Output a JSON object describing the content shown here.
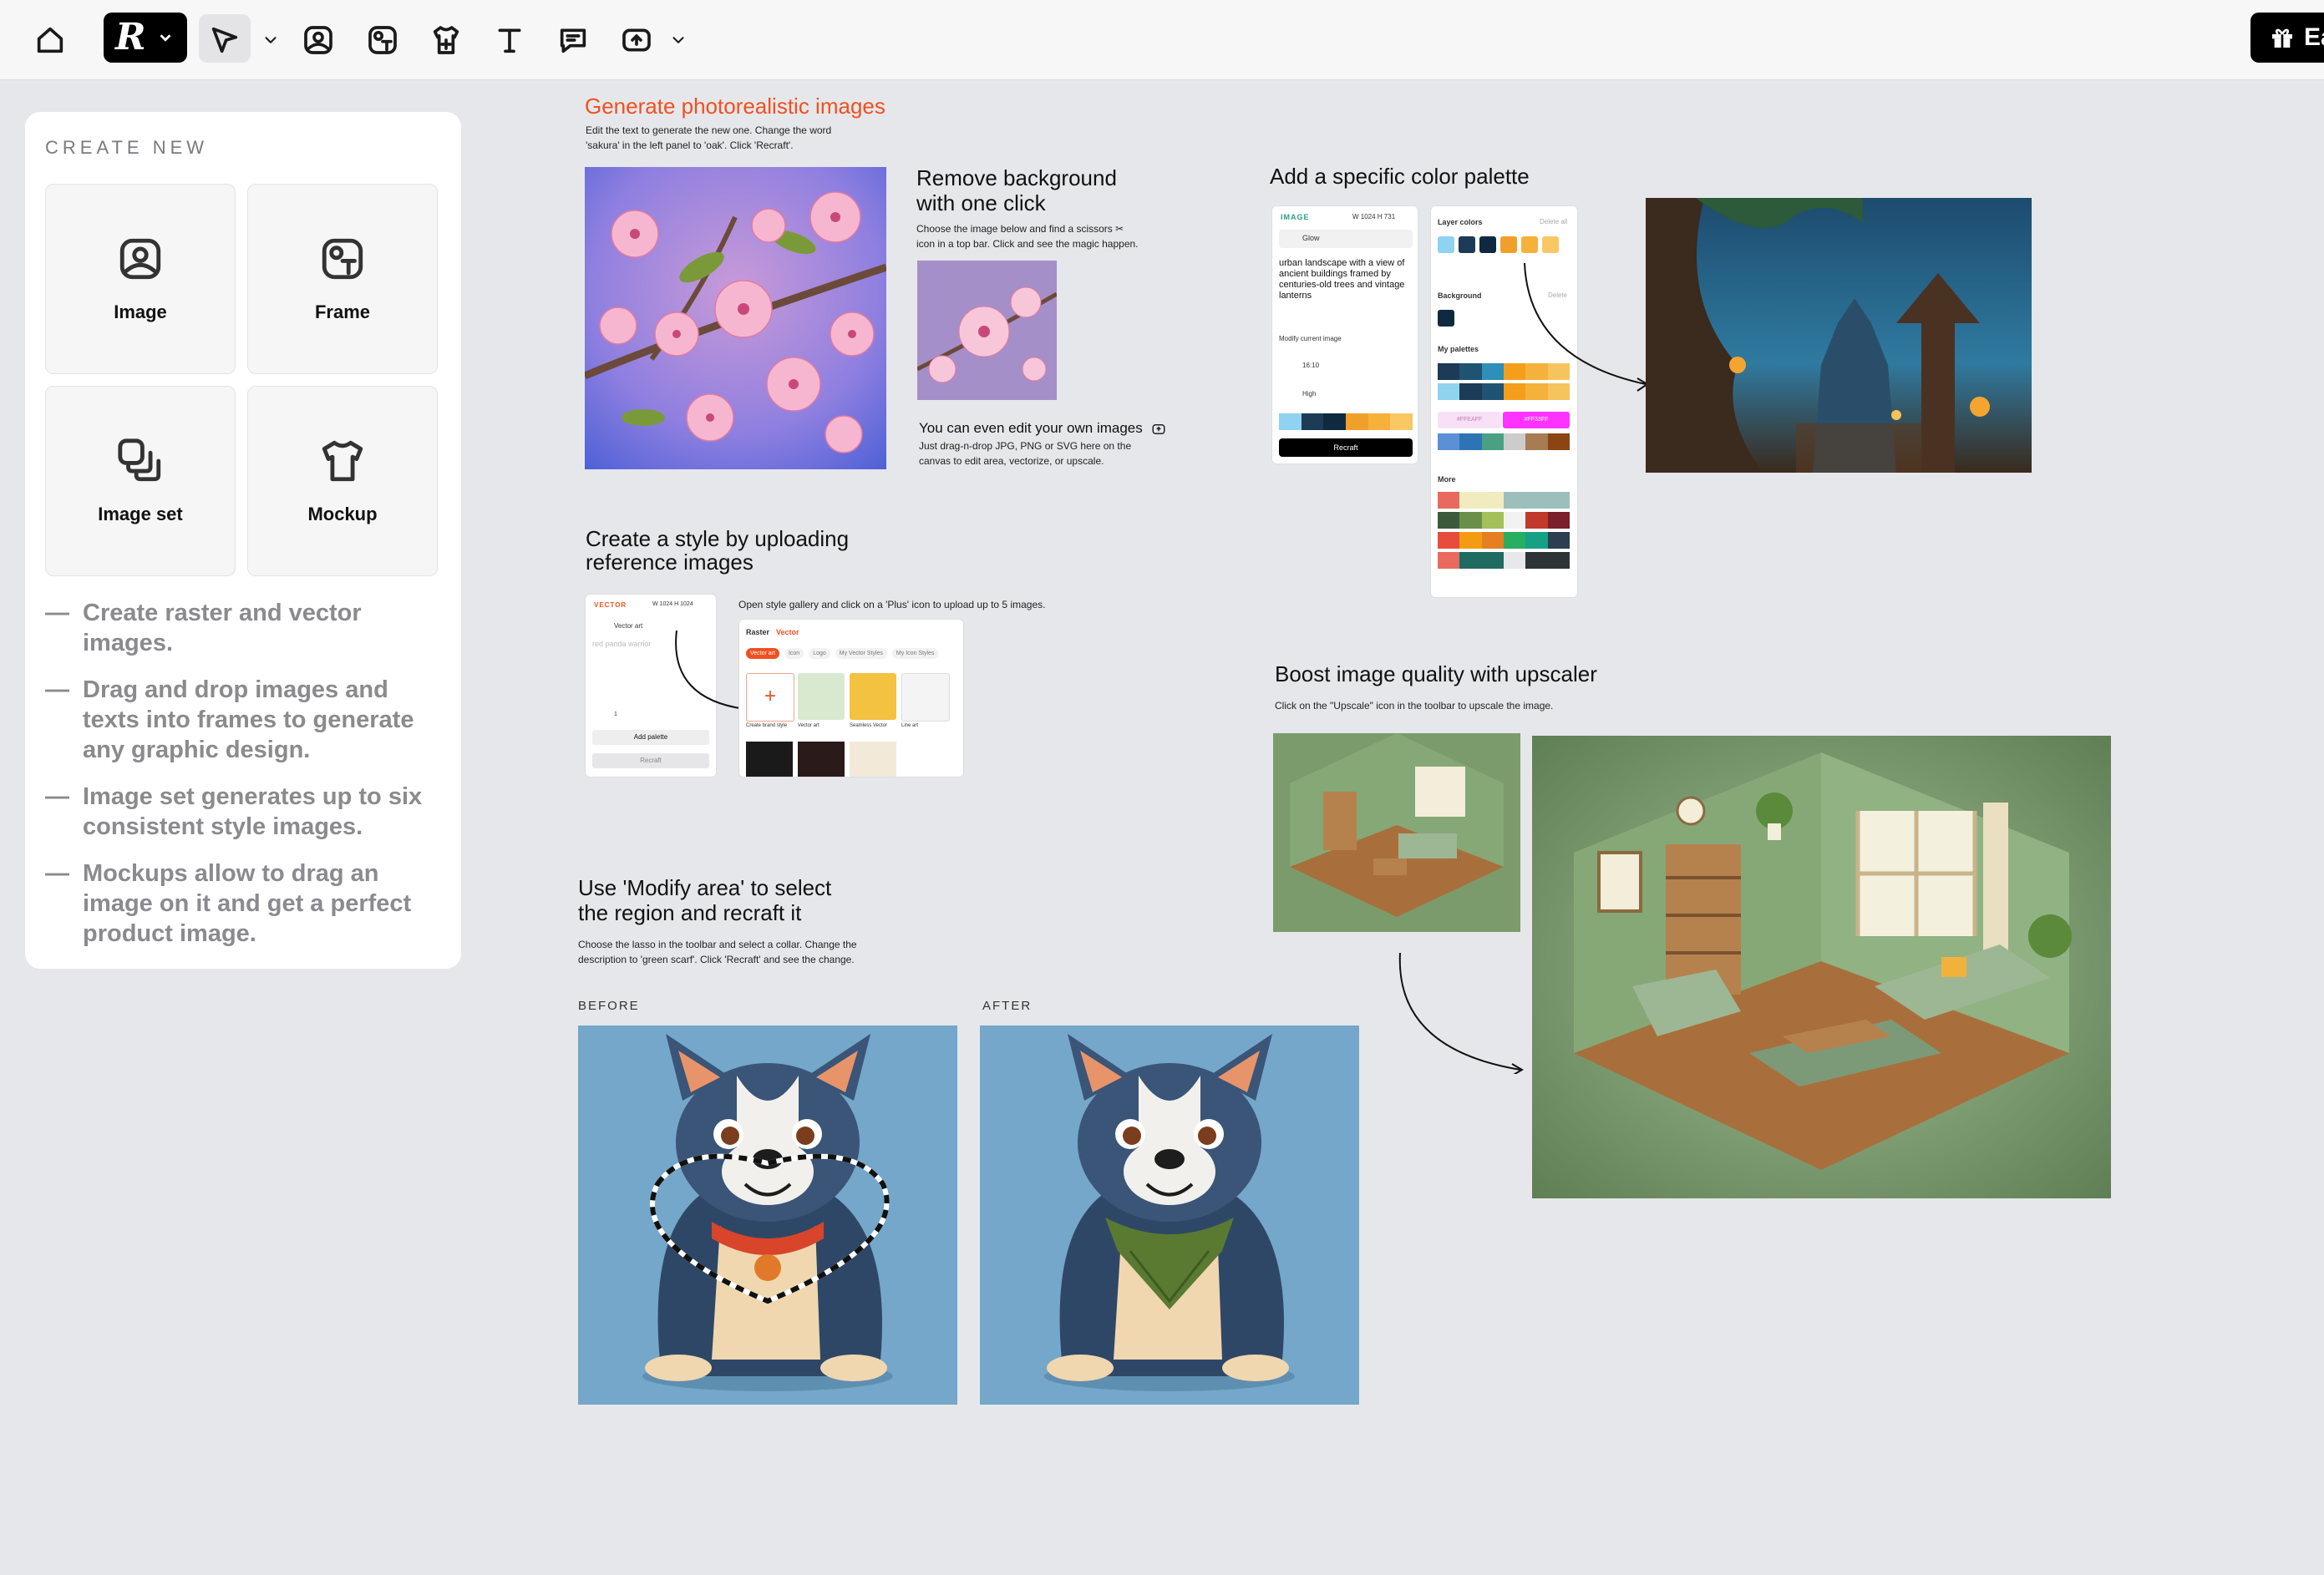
{
  "toolbar": {
    "icons": [
      "home-icon",
      "logo-menu",
      "select-tool-icon",
      "image-tool-icon",
      "frame-tool-icon",
      "mockup-tool-icon",
      "text-tool-icon",
      "comment-tool-icon",
      "upload-tool-icon"
    ],
    "logo_letter": "R",
    "gift_label": "Ea"
  },
  "panel": {
    "title": "CREATE NEW",
    "cards": [
      {
        "label": "Image",
        "icon": "image-icon"
      },
      {
        "label": "Frame",
        "icon": "frame-icon"
      },
      {
        "label": "Image set",
        "icon": "image-set-icon"
      },
      {
        "label": "Mockup",
        "icon": "mockup-icon"
      }
    ],
    "tips": [
      "Create raster and vector images.",
      "Drag and drop images and texts into frames to generate any graphic design.",
      "Image set generates up to six consistent style images.",
      "Mockups allow to drag an image on it and get a perfect product image."
    ]
  },
  "canvas": {
    "photoreal": {
      "title": "Generate photorealistic images",
      "desc1": "Edit the text to generate the new one. Change the word",
      "desc2": "'sakura' in the left panel to 'oak'. Click 'Recraft'."
    },
    "removebg": {
      "title1": "Remove background",
      "title2": "with one click",
      "desc1": "Choose the image below and find a scissors ✂",
      "desc2": "icon in a top bar. Click and see the magic happen.",
      "edit_title": "You can even edit your own images",
      "edit_desc1": "Just drag-n-drop JPG, PNG or SVG here on the",
      "edit_desc2": "canvas to edit area, vectorize, or upscale."
    },
    "palette": {
      "title": "Add a specific color palette",
      "mini_header": "IMAGE",
      "mini_dims": "W 1024  H 731",
      "mini_style": "Glow",
      "mini_prompt": "urban landscape with a view of ancient buildings framed by centuries-old trees and vintage lanterns",
      "mini_modify": "Modify current image",
      "mini_ratio": "16:10",
      "mini_quality": "High",
      "mini_button": "Recraft",
      "layer_colors": "Layer colors",
      "delete_all": "Delete all",
      "background": "Background",
      "delete": "Delete",
      "my_palettes": "My palettes",
      "more": "More",
      "hex1": "#FFEAFF",
      "hex2": "#FF33FF",
      "layer_swatches": [
        "#8fd3f0",
        "#1d3a57",
        "#0f2a40",
        "#f0a02a",
        "#f6b13a",
        "#f9c763"
      ],
      "palette_rows": [
        [
          "#1b3b56",
          "#1f5372",
          "#2e8fb8",
          "#f59e1b",
          "#f4b23c",
          "#f6c45d"
        ],
        [
          "#8fd3ef",
          "#1b3b56",
          "#1f5372",
          "#f59e1b",
          "#f4b23c",
          "#f6c45d"
        ],
        [
          "#5b8fd6",
          "#2e74b5",
          "#4aa083",
          "#cccccc",
          "#a67c52",
          "#8b4513"
        ],
        [
          "#e86a5e",
          "#f1ecc0",
          "#f1ecc0",
          "#9dbfbc",
          "#9dbfbc",
          "#9dbfbc"
        ],
        [
          "#3c5a3b",
          "#6a8f4a",
          "#a3c05a",
          "#f2f2f2",
          "#c0392b",
          "#7a1f2b"
        ],
        [
          "#e74c3c",
          "#f39c12",
          "#e67e22",
          "#27ae60",
          "#16a085",
          "#2c3e50"
        ],
        [
          "#e86a5e",
          "#1f6b62",
          "#1f6b62",
          "#e8e8ea",
          "#2d3436",
          "#2d3436"
        ]
      ]
    },
    "style": {
      "title1": "Create a style by uploading",
      "title2": "reference images",
      "desc": "Open style gallery and click on a 'Plus' icon to upload up to 5 images.",
      "mini_header": "VECTOR",
      "mini_dims": "W 1024  H 1024",
      "mini_style": "Vector art",
      "mini_prompt": "red panda warrior",
      "mini_count": "1",
      "mini_add": "Add palette",
      "mini_button": "Recraft",
      "tab_raster": "Raster",
      "tab_vector": "Vector",
      "chips": [
        "Vector art",
        "Icon",
        "Logo",
        "My Vector Styles",
        "My Icon Styles"
      ],
      "thumb_labels": [
        "Create brand style",
        "Vector art",
        "Seamless Vector",
        "Line art"
      ]
    },
    "modify": {
      "title1": "Use 'Modify area' to select",
      "title2": "the region  and recraft it",
      "desc1": "Choose the lasso in the toolbar and select a collar. Change the",
      "desc2": "description to 'green scarf'. Click 'Recraft' and see the change.",
      "before": "BEFORE",
      "after": "AFTER"
    },
    "upscale": {
      "title": "Boost image quality with upscaler",
      "desc": "Click on the \"Upscale\" icon in the toolbar to  upscale the image."
    }
  },
  "colors": {
    "accent": "#f0501f",
    "canvas_bg": "#e6e7ea",
    "dog_bg": "#74a7c9",
    "room_bg": "#7b9b6c"
  }
}
